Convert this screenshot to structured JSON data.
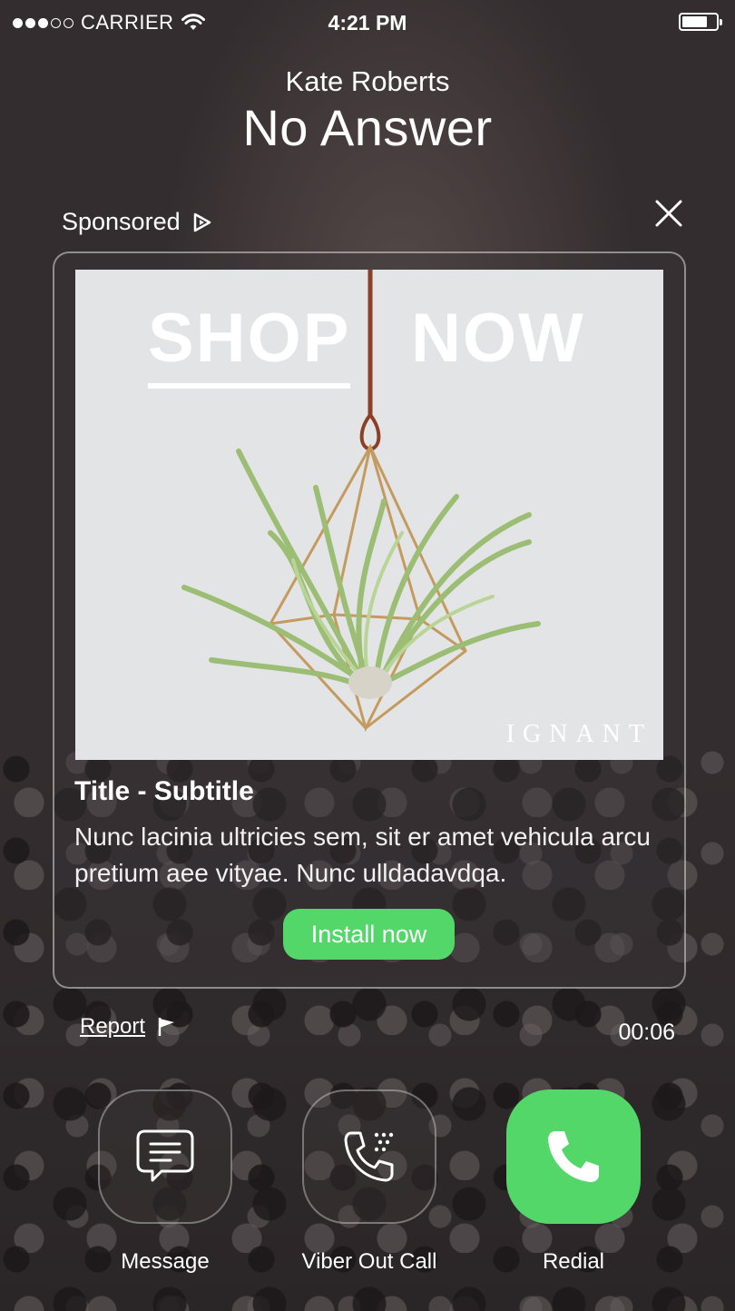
{
  "status_bar": {
    "carrier": "CARRIER",
    "time": "4:21 PM",
    "signal_dots_filled": 3,
    "signal_dots_total": 5,
    "battery_level": 0.75
  },
  "call": {
    "caller_name": "Kate Roberts",
    "status": "No Answer",
    "duration": "00:06"
  },
  "ad": {
    "sponsored_label": "Sponsored",
    "image_text_left": "SHOP",
    "image_text_right": "NOW",
    "image_watermark": "IGNANT",
    "title": "Title - Subtitle",
    "description": "Nunc lacinia ultricies sem, sit er amet vehicula arcu pretium aee vityae. Nunc ulldadavdqa.",
    "cta_label": "Install now",
    "report_label": "Report"
  },
  "actions": [
    {
      "label": "Message",
      "icon": "message-bubble-icon"
    },
    {
      "label": "Viber Out Call",
      "icon": "viber-out-call-icon"
    },
    {
      "label": "Redial",
      "icon": "phone-icon"
    }
  ],
  "colors": {
    "accent_green": "#53d769",
    "image_bg": "#e3e4e6"
  }
}
